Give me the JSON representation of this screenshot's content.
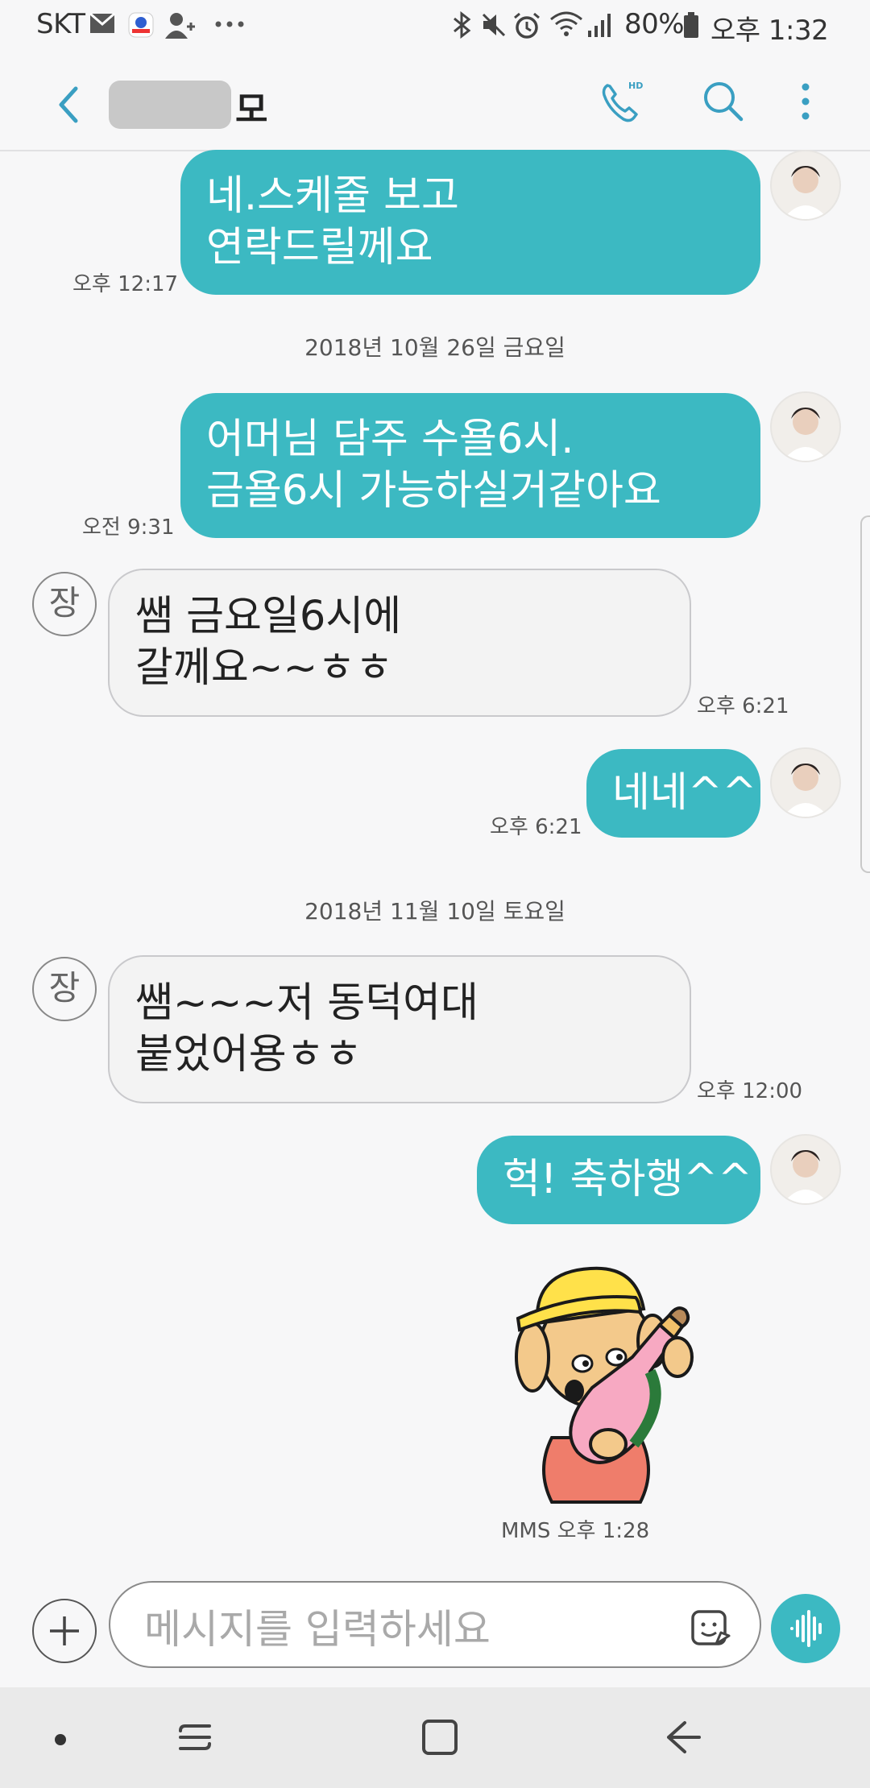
{
  "status_bar": {
    "carrier": "SKT",
    "battery": "80%",
    "time": "오후 1:32"
  },
  "header": {
    "contact_suffix": "모"
  },
  "messages": [
    {
      "kind": "out",
      "lines": [
        "네.스케줄 보고",
        "연락드릴께요"
      ],
      "time": "오후 12:17"
    },
    {
      "kind": "date",
      "text": "2018년 10월 26일 금요일"
    },
    {
      "kind": "out",
      "lines": [
        "어머님 담주 수욜6시.",
        "금욜6시 가능하실거같아요"
      ],
      "time": "오전 9:31"
    },
    {
      "kind": "in",
      "avatar": "장",
      "lines": [
        "쌤 금요일6시에",
        "갈께요~~ㅎㅎ"
      ],
      "time": "오후 6:21"
    },
    {
      "kind": "out",
      "lines": [
        "네네^^"
      ],
      "time": "오후 6:21"
    },
    {
      "kind": "date",
      "text": "2018년 11월 10일 토요일"
    },
    {
      "kind": "in",
      "avatar": "장",
      "lines": [
        "쌤~~~저 동덕여대",
        "붙었어용ㅎㅎ"
      ],
      "time": "오후 12:00"
    },
    {
      "kind": "out",
      "lines": [
        "헉! 축하행^^"
      ],
      "time": ""
    },
    {
      "kind": "sticker",
      "time": "MMS 오후 1:28"
    }
  ],
  "composer": {
    "placeholder": "메시지를 입력하세요"
  },
  "icons": [
    "back-arrow-icon",
    "hd-call-icon",
    "search-icon",
    "more-vert-icon",
    "plus-icon",
    "sticker-icon",
    "voice-icon",
    "recent-apps-icon",
    "home-icon",
    "nav-back-icon"
  ],
  "colors": {
    "accent": "#3cb9c2",
    "incoming_bubble": "#f3f3f3",
    "background": "#f7f7f8"
  }
}
